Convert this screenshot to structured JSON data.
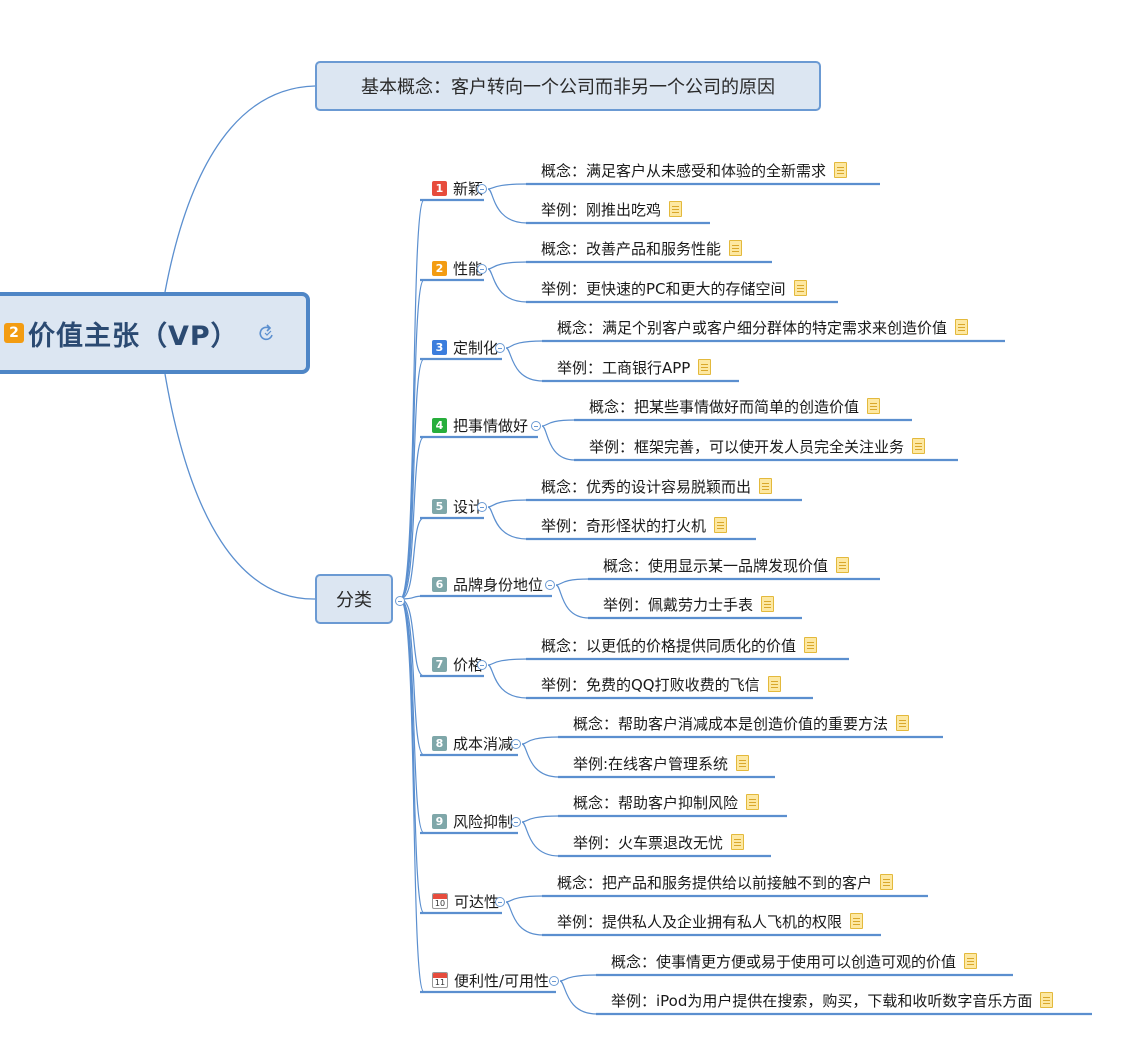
{
  "root": {
    "badge": "2",
    "label": "价值主张（VP）",
    "icon": "refresh-arrow-icon"
  },
  "concept_topic": {
    "label": "基本概念：客户转向一个公司而非另一个公司的原因"
  },
  "category_topic": {
    "label": "分类"
  },
  "categories": [
    {
      "marker": "1",
      "marker_type": "badge",
      "color": "#e74c3c",
      "label": "新颖",
      "children": [
        "概念：满足客户从未感受和体验的全新需求",
        "举例：刚推出吃鸡"
      ]
    },
    {
      "marker": "2",
      "marker_type": "badge",
      "color": "#f39c12",
      "label": "性能",
      "children": [
        "概念：改善产品和服务性能",
        "举例：更快速的PC和更大的存储空间"
      ]
    },
    {
      "marker": "3",
      "marker_type": "badge",
      "color": "#3b7ddd",
      "label": "定制化",
      "children": [
        "概念：满足个别客户或客户细分群体的特定需求来创造价值",
        "举例：工商银行APP"
      ]
    },
    {
      "marker": "4",
      "marker_type": "badge",
      "color": "#27ae3c",
      "label": "把事情做好",
      "children": [
        "概念：把某些事情做好而简单的创造价值",
        "举例：框架完善，可以使开发人员完全关注业务"
      ]
    },
    {
      "marker": "5",
      "marker_type": "badge",
      "color": "#7fa7a9",
      "label": "设计",
      "children": [
        "概念：优秀的设计容易脱颖而出",
        "举例：奇形怪状的打火机"
      ]
    },
    {
      "marker": "6",
      "marker_type": "badge",
      "color": "#7fa7a9",
      "label": "品牌身份地位",
      "children": [
        "概念：使用显示某一品牌发现价值",
        "举例：佩戴劳力士手表"
      ]
    },
    {
      "marker": "7",
      "marker_type": "badge",
      "color": "#7fa7a9",
      "label": "价格",
      "children": [
        "概念：以更低的价格提供同质化的价值",
        "举例：免费的QQ打败收费的飞信"
      ]
    },
    {
      "marker": "8",
      "marker_type": "badge",
      "color": "#7fa7a9",
      "label": "成本消减",
      "children": [
        "概念：帮助客户消减成本是创造价值的重要方法",
        "举例:在线客户管理系统"
      ]
    },
    {
      "marker": "9",
      "marker_type": "badge",
      "color": "#7fa7a9",
      "label": "风险抑制",
      "children": [
        "概念：帮助客户抑制风险",
        "举例：火车票退改无忧"
      ]
    },
    {
      "marker": "10",
      "marker_type": "calendar",
      "color": "#e74c3c",
      "label": "可达性",
      "children": [
        "概念：把产品和服务提供给以前接触不到的客户",
        "举例：提供私人及企业拥有私人飞机的权限"
      ]
    },
    {
      "marker": "11",
      "marker_type": "calendar",
      "color": "#e74c3c",
      "label": "便利性/可用性",
      "children": [
        "概念：使事情更方便或易于使用可以创造可观的价值",
        "举例：iPod为用户提供在搜索，购买，下载和收听数字音乐方面"
      ]
    }
  ],
  "colors": {
    "line": "#5b8fcf",
    "topic_fill": "#dce6f2",
    "root_border": "#4f86c6"
  },
  "icons": {
    "collapse": "collapse-minus-icon",
    "note": "note-icon"
  }
}
